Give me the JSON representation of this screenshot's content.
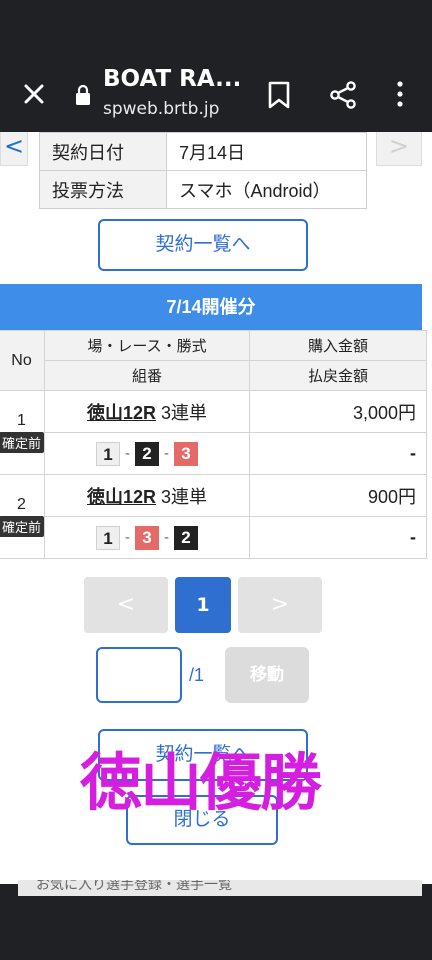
{
  "browser": {
    "title": "BOAT RA...",
    "url": "spweb.brtb.jp"
  },
  "info_table": [
    {
      "label": "契約日付",
      "value": "7月14日"
    },
    {
      "label": "投票方法",
      "value": "スマホ（Android）"
    }
  ],
  "nav": {
    "prev": "<",
    "next": ">"
  },
  "buttons": {
    "contract_list_top": "契約一覧へ",
    "contract_list_bottom": "契約一覧へ",
    "close": "閉じる",
    "move": "移動"
  },
  "section_title": "7/14開催分",
  "table": {
    "headers": {
      "no": "No",
      "race": "場・レース・勝式",
      "purchase": "購入金額",
      "combo": "組番",
      "refund": "払戻金額"
    },
    "rows": [
      {
        "no": "1",
        "status": "確定前",
        "race_link": "徳山12R",
        "bet_type": "3連単",
        "purchase": "3,000円",
        "refund": "-",
        "combo": [
          {
            "n": "1",
            "style": "white"
          },
          {
            "n": "2",
            "style": "black"
          },
          {
            "n": "3",
            "style": "red"
          }
        ]
      },
      {
        "no": "2",
        "status": "確定前",
        "race_link": "徳山12R",
        "bet_type": "3連単",
        "purchase": "900円",
        "refund": "-",
        "combo": [
          {
            "n": "1",
            "style": "white"
          },
          {
            "n": "3",
            "style": "red"
          },
          {
            "n": "2",
            "style": "black"
          }
        ]
      }
    ],
    "combo_sep": "-"
  },
  "pagination": {
    "prev": "<",
    "current": "1",
    "next": ">",
    "total": "/1"
  },
  "overlay_text": "徳山優勝",
  "bottom_peek": "お気に入り選手登録・選手一覧",
  "colors": {
    "accent": "#2f6fd0",
    "header_blue": "#3e8de8",
    "overlay_magenta": "#d61ee0",
    "box_red": "#e46a68",
    "box_black": "#222222"
  }
}
